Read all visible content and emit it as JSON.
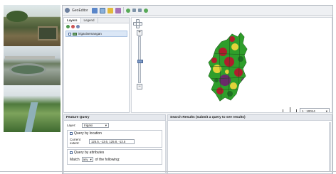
{
  "app": {
    "title": "GeoEditor"
  },
  "toolbar": {
    "icons": [
      "blue-icon",
      "grid-icon",
      "yellow-icon",
      "purple-icon",
      "green-dot-icon",
      "small-icon"
    ]
  },
  "layers_panel": {
    "tabs": [
      "Layers",
      "Legend"
    ],
    "active_tab": "Layers",
    "items": [
      {
        "label": "irigasisemangan",
        "checked": true
      }
    ]
  },
  "map": {
    "zoom_level": 0.4,
    "scale": {
      "label": "1 : 10014",
      "bar_label": "1km"
    },
    "colors": {
      "green": "#2f9e2b",
      "dark_green": "#1f6f23",
      "red": "#b01d2c",
      "yellow": "#e3d33a",
      "purple": "#6a2a6a"
    }
  },
  "feature_query": {
    "title": "Feature Query",
    "layer_label": "Layer:",
    "layer_value": "Irigasi",
    "by_location_label": "Query by location",
    "current_extent_label": "Current extent:",
    "current_extent_value": "125.5, -13.6, 125.8, -13.5",
    "by_attributes_label": "Query by attributes",
    "match_label": "Match",
    "match_value": "any",
    "of_following_label": "of the following:"
  },
  "search_results": {
    "title": "Search Results (submit a query to see results)"
  }
}
